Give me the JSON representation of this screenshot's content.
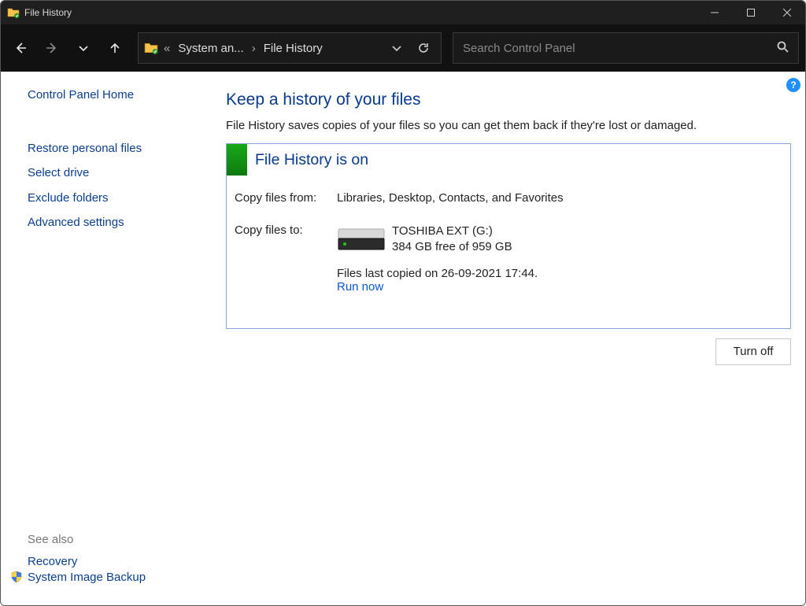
{
  "window": {
    "title": "File History"
  },
  "breadcrumb": {
    "item1": "System an...",
    "item2": "File History"
  },
  "search": {
    "placeholder": "Search Control Panel"
  },
  "sidebar": {
    "home": "Control Panel Home",
    "links": {
      "restore": "Restore personal files",
      "selectDrive": "Select drive",
      "exclude": "Exclude folders",
      "advanced": "Advanced settings"
    },
    "seeAlso": "See also",
    "recovery": "Recovery",
    "systemImage": "System Image Backup"
  },
  "main": {
    "heading": "Keep a history of your files",
    "subtext": "File History saves copies of your files so you can get them back if they're lost or damaged.",
    "statusTitle": "File History is on",
    "copyFromLabel": "Copy files from:",
    "copyFromValue": "Libraries, Desktop, Contacts, and Favorites",
    "copyToLabel": "Copy files to:",
    "driveName": "TOSHIBA EXT (G:)",
    "driveFree": "384 GB free of 959 GB",
    "lastCopied": "Files last copied on 26-09-2021 17:44.",
    "runNow": "Run now",
    "turnOff": "Turn off"
  }
}
